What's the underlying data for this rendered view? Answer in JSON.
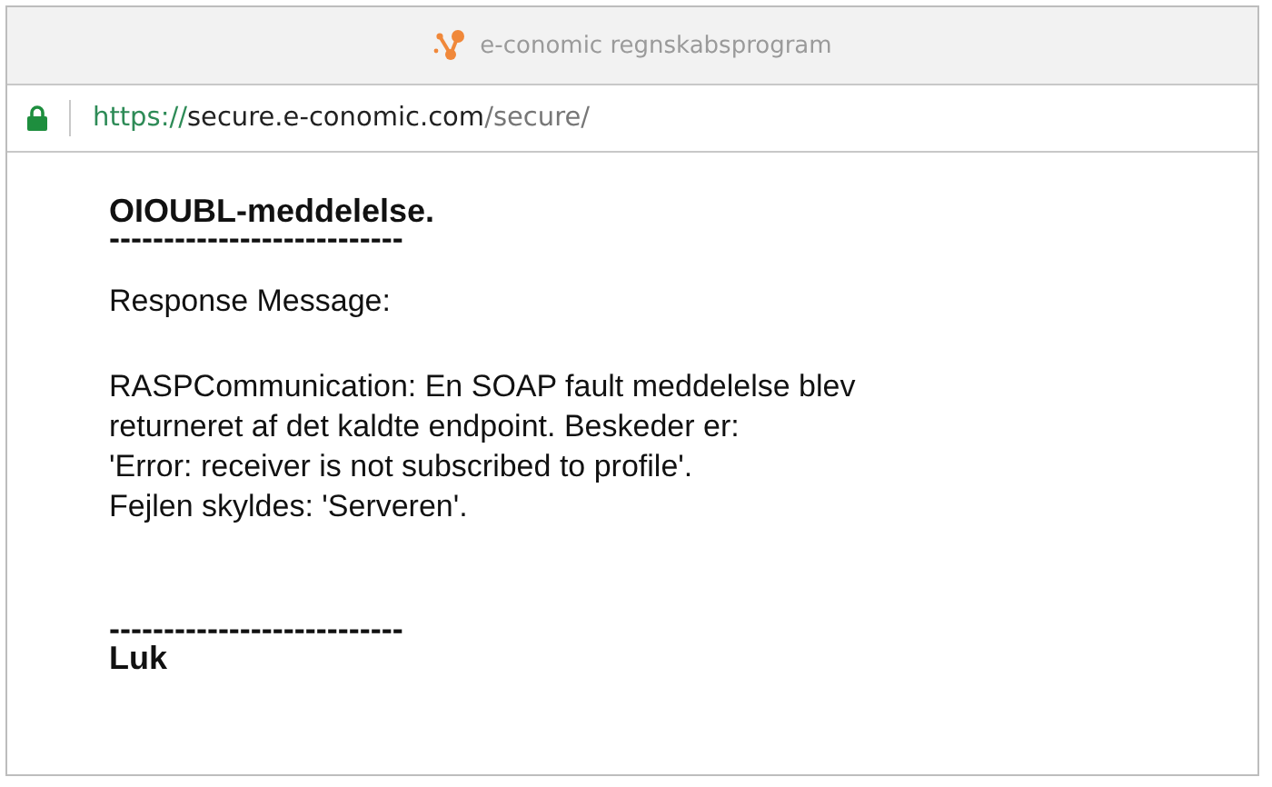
{
  "window": {
    "title": "e-conomic regnskabsprogram"
  },
  "address_bar": {
    "scheme": "https://",
    "host": "secure.e-conomic.com",
    "path": "/secure/"
  },
  "content": [
    {
      "kind": "heading",
      "text": "OIOUBL-meddelelse."
    },
    {
      "kind": "rule",
      "text": "---------------------------"
    },
    {
      "kind": "label",
      "text": "Response Message:"
    },
    {
      "kind": "paragraph",
      "text": "RASPCommunication: En SOAP fault meddelelse blev\nreturneret af det kaldte endpoint. Beskeder er:\n'Error: receiver is not subscribed to profile'.\nFejlen skyldes: 'Serveren'."
    },
    {
      "kind": "rule",
      "text": "---------------------------"
    },
    {
      "kind": "link",
      "text": "Luk"
    }
  ]
}
